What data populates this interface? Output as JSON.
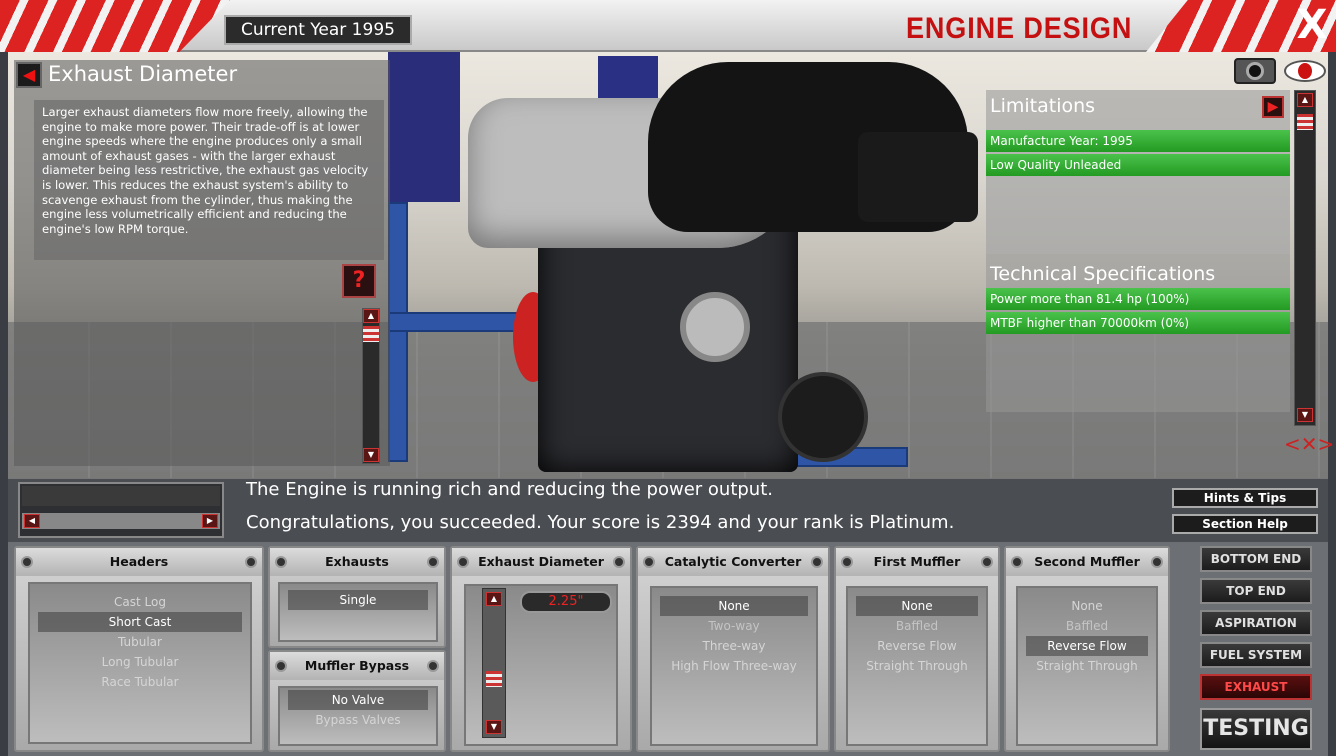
{
  "header": {
    "current_year": "Current Year 1995",
    "title": "ENGINE DESIGN",
    "close": "X"
  },
  "info": {
    "title": "Exhaust Diameter",
    "description": "Larger exhaust diameters flow more freely, allowing the engine to make more power. Their trade-off is at lower engine speeds where the engine produces only a small amount of exhaust gases - with the larger exhaust diameter being less restrictive, the exhaust gas velocity is lower. This reduces the exhaust system's ability to scavenge exhaust from the cylinder, thus making the engine less volumetrically efficient and reducing the engine's low RPM torque.",
    "help_button": "?"
  },
  "limitations": {
    "title": "Limitations",
    "items": [
      "Manufacture Year: 1995",
      "Low Quality Unleaded"
    ]
  },
  "specs": {
    "title": "Technical Specifications",
    "items": [
      "Power more than 81.4 hp (100%)",
      "MTBF higher than 70000km (0%)"
    ]
  },
  "status": {
    "line1": "The Engine is running rich and reducing the power output.",
    "line2": "Congratulations, you succeeded. Your score is 2394  and your rank is Platinum."
  },
  "hints": {
    "hints_tips": "Hints & Tips",
    "section_help": "Section Help"
  },
  "panels": {
    "headers": {
      "title": "Headers",
      "options": [
        "Cast Log",
        "Short Cast",
        "Tubular",
        "Long Tubular",
        "Race Tubular"
      ],
      "selected": "Short Cast"
    },
    "exhausts": {
      "title": "Exhausts",
      "options": [
        "Single"
      ],
      "selected": "Single"
    },
    "muffler_bypass": {
      "title": "Muffler Bypass",
      "options": [
        "No Valve",
        "Bypass Valves"
      ],
      "selected": "No Valve"
    },
    "exhaust_diameter": {
      "title": "Exhaust Diameter",
      "value": "2.25\"",
      "fraction": 0.33
    },
    "catalytic": {
      "title": "Catalytic Converter",
      "options": [
        "None",
        "Two-way",
        "Three-way",
        "High Flow Three-way"
      ],
      "selected": "None"
    },
    "first_muffler": {
      "title": "First Muffler",
      "options": [
        "None",
        "Baffled",
        "Reverse Flow",
        "Straight Through"
      ],
      "selected": "None"
    },
    "second_muffler": {
      "title": "Second Muffler",
      "options": [
        "None",
        "Baffled",
        "Reverse Flow",
        "Straight Through"
      ],
      "selected": "Reverse Flow"
    }
  },
  "nav": {
    "items": [
      "BOTTOM END",
      "TOP END",
      "ASPIRATION",
      "FUEL SYSTEM",
      "EXHAUST"
    ],
    "active": "EXHAUST",
    "testing": "TESTING"
  },
  "colors": {
    "accent_red": "#c41010",
    "green_row": "#239b23"
  }
}
